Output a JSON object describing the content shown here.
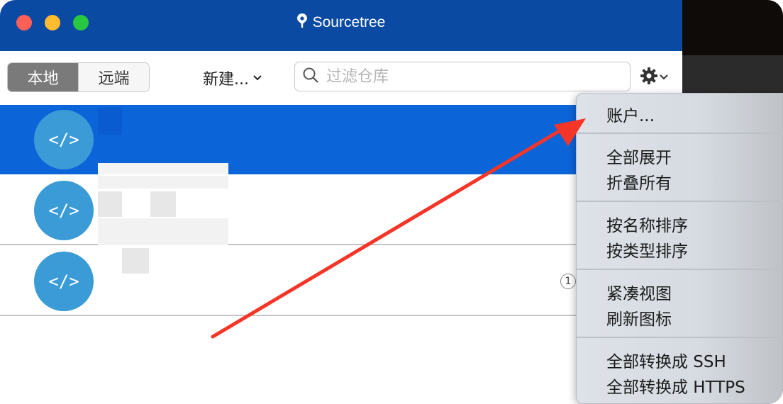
{
  "window": {
    "title": "Sourcetree",
    "traffic_lights": {
      "close": "#fe5f57",
      "minimize": "#febc2e",
      "zoom": "#28c840"
    },
    "titlebar_color": "#0a4aa3"
  },
  "toolbar": {
    "segments": [
      {
        "label": "本地",
        "selected": true
      },
      {
        "label": "远端",
        "selected": false
      }
    ],
    "new_label": "新建...",
    "search": {
      "placeholder": "过滤仓库",
      "value": ""
    },
    "settings_icon": "gear-icon"
  },
  "repos": {
    "selected_color": "#0b64d8",
    "avatar_icon": "code-icon",
    "avatar_glyph": "</>",
    "badge_text": "1"
  },
  "menu": {
    "items": [
      "账户...",
      "全部展开",
      "折叠所有",
      "按名称排序",
      "按类型排序",
      "紧凑视图",
      "刷新图标",
      "全部转换成 SSH",
      "全部转换成 HTTPS"
    ]
  },
  "annotation": {
    "arrow_color": "#f53527"
  }
}
